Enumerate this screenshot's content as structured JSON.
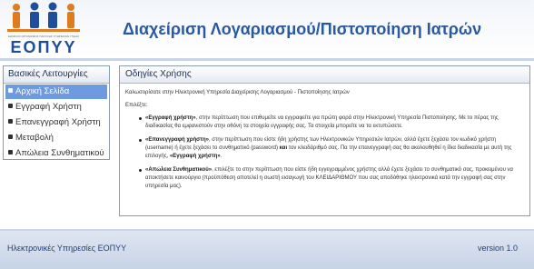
{
  "header": {
    "logo_small": "ΕΘΝΙΚΟΣ ΟΡΓΑΝΙΣΜΟΣ ΠΑΡΟΧΗΣ ΥΠΗΡΕΣΙΩΝ ΥΓΕΙΑΣ",
    "logo_text": "ΕΟΠΥΥ",
    "title": "Διαχείριση Λογαριασμού/Πιστοποίηση Ιατρών"
  },
  "sidebar": {
    "heading": "Βασικές Λειτουργίες",
    "items": [
      {
        "label": "Αρχική Σελίδα",
        "active": true
      },
      {
        "label": "Εγγραφή Χρήστη",
        "active": false
      },
      {
        "label": "Επανεγγραφή Χρήστη",
        "active": false
      },
      {
        "label": "Μεταβολή",
        "active": false
      },
      {
        "label": "Απώλεια Συνθηματικού",
        "active": false
      }
    ]
  },
  "main": {
    "heading": "Οδηγίες Χρήσης",
    "welcome": "Καλωσορίσατε στην Ηλεκτρονική Υπηρεσία Διαχείρισης Λογαριασμού - Πιστοποίησης Ιατρών",
    "choose": "Επιλέξτε:",
    "options": [
      {
        "title": "«Εγγραφή χρήστη»",
        "text": ", στην περίπτωση που επιθυμείτε να εγγραφείτε για πρώτη φορά στην Ηλεκτρονική Υπηρεσία Πιστοποίησης. Με το πέρας της διαδικασίας θα εμφανιστούν στην οθόνη τα στοιχεία εγγραφής σας. Τα στοιχεία μπορείτε να τα εκτυπώσετε."
      },
      {
        "title": "«Επανεγγραφή χρήστη»",
        "text": ", στην περίπτωση που είστε ήδη χρήστης των Ηλεκτρονικών Υπηρεσιών Ιατρών, αλλά έχετε ξεχάσει τον κωδικό χρήστη (username) ή έχετε ξεχάσει το συνθηματικό (password)",
        "bold_and": "και",
        "text2": "τον κλειδάριθμό σας. Πα την επανεγγραφή σας θα ακολουθηθεί η ίδια διαδικασία με αυτή της επιλογής,",
        "title2": "«Εγγραφή χρήστη»",
        "end": "."
      },
      {
        "title": "«Απώλεια Συνθηματικού»",
        "text": ", επιλέξτε το στην περίπτωση που είστε ήδη εγγεγραμμένος χρήστης αλλά έχετε ξεχάσει το συνθηματικό σας, προκειμένου να αποκτήσετε καινούργιο (προϋπόθεση αποτελεί η σωστή εισαγωγή του ΚΛΕΙΔΑΡΙΘΜΟΥ που σας αποδόθηκε ηλεκτρονικά κατά την εγγραφή σας στην υπηρεσία μας)."
      }
    ]
  },
  "footer": {
    "left": "Ηλεκτρονικές Υπηρεσίες ΕΟΠΥΥ",
    "right": "version 1.0"
  },
  "colors": {
    "brand": "#2a59a3",
    "logo_blue": "#1f4f9a",
    "logo_orange": "#e07b1f",
    "active_menu": "#6e9ae0"
  }
}
